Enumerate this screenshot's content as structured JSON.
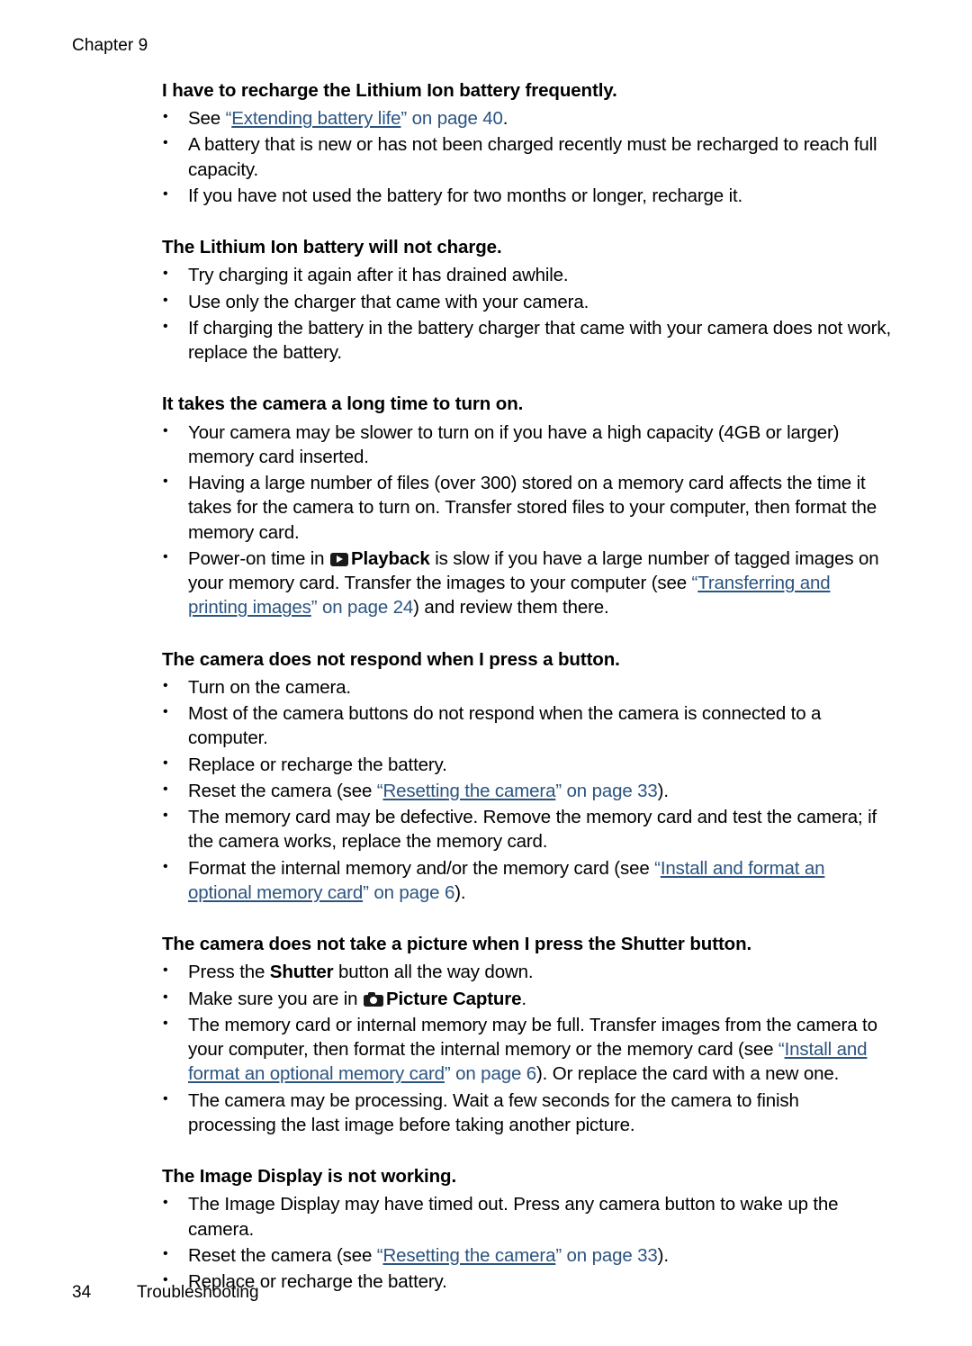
{
  "page": {
    "running_head": "Chapter 9",
    "footer_page_number": "34",
    "footer_section": "Troubleshooting",
    "link_color": "#2b5480",
    "text_color": "#000000",
    "background_color": "#ffffff"
  },
  "icons": {
    "playback": "playback-icon",
    "picture_capture": "camera-icon"
  },
  "sections": [
    {
      "heading": "I have to recharge the Lithium Ion battery frequently.",
      "bullets": [
        {
          "parts": [
            {
              "type": "text",
              "text": "See "
            },
            {
              "type": "quote",
              "text": "“"
            },
            {
              "type": "link",
              "text": "Extending battery life"
            },
            {
              "type": "quote",
              "text": "”"
            },
            {
              "type": "pagenum",
              "text": " on page 40"
            },
            {
              "type": "text",
              "text": "."
            }
          ]
        },
        {
          "parts": [
            {
              "type": "text",
              "text": "A battery that is new or has not been charged recently must be recharged to reach full capacity."
            }
          ]
        },
        {
          "parts": [
            {
              "type": "text",
              "text": "If you have not used the battery for two months or longer, recharge it."
            }
          ]
        }
      ]
    },
    {
      "heading": "The Lithium Ion battery will not charge.",
      "bullets": [
        {
          "parts": [
            {
              "type": "text",
              "text": "Try charging it again after it has drained awhile."
            }
          ]
        },
        {
          "parts": [
            {
              "type": "text",
              "text": "Use only the charger that came with your camera."
            }
          ]
        },
        {
          "parts": [
            {
              "type": "text",
              "text": "If charging the battery in the battery charger that came with your camera does not work, replace the battery."
            }
          ]
        }
      ]
    },
    {
      "heading": "It takes the camera a long time to turn on.",
      "bullets": [
        {
          "parts": [
            {
              "type": "text",
              "text": "Your camera may be slower to turn on if you have a high capacity (4GB or larger) memory card inserted."
            }
          ]
        },
        {
          "parts": [
            {
              "type": "text",
              "text": "Having a large number of files (over 300) stored on a memory card affects the time it takes for the camera to turn on. Transfer stored files to your computer, then format the memory card."
            }
          ]
        },
        {
          "parts": [
            {
              "type": "text",
              "text": "Power-on time in "
            },
            {
              "type": "icon",
              "icon": "playback"
            },
            {
              "type": "bold",
              "text": "Playback"
            },
            {
              "type": "text",
              "text": " is slow if you have a large number of tagged images on your memory card. Transfer the images to your computer (see "
            },
            {
              "type": "quote",
              "text": "“"
            },
            {
              "type": "link",
              "text": "Transferring and printing images"
            },
            {
              "type": "quote",
              "text": "”"
            },
            {
              "type": "pagenum",
              "text": " on page 24"
            },
            {
              "type": "text",
              "text": ") and review them there."
            }
          ]
        }
      ]
    },
    {
      "heading": "The camera does not respond when I press a button.",
      "bullets": [
        {
          "parts": [
            {
              "type": "text",
              "text": "Turn on the camera."
            }
          ]
        },
        {
          "parts": [
            {
              "type": "text",
              "text": "Most of the camera buttons do not respond when the camera is connected to a computer."
            }
          ]
        },
        {
          "parts": [
            {
              "type": "text",
              "text": "Replace or recharge the battery."
            }
          ]
        },
        {
          "parts": [
            {
              "type": "text",
              "text": "Reset the camera (see "
            },
            {
              "type": "quote",
              "text": "“"
            },
            {
              "type": "link",
              "text": "Resetting the camera"
            },
            {
              "type": "quote",
              "text": "”"
            },
            {
              "type": "pagenum",
              "text": " on page 33"
            },
            {
              "type": "text",
              "text": ")."
            }
          ]
        },
        {
          "parts": [
            {
              "type": "text",
              "text": "The memory card may be defective. Remove the memory card and test the camera; if the camera works, replace the memory card."
            }
          ]
        },
        {
          "parts": [
            {
              "type": "text",
              "text": "Format the internal memory and/or the memory card (see "
            },
            {
              "type": "quote",
              "text": "“"
            },
            {
              "type": "link",
              "text": "Install and format an optional memory card"
            },
            {
              "type": "quote",
              "text": "”"
            },
            {
              "type": "pagenum",
              "text": " on page 6"
            },
            {
              "type": "text",
              "text": ")."
            }
          ]
        }
      ]
    },
    {
      "heading": "The camera does not take a picture when I press the Shutter button.",
      "bullets": [
        {
          "parts": [
            {
              "type": "text",
              "text": "Press the "
            },
            {
              "type": "bold",
              "text": "Shutter"
            },
            {
              "type": "text",
              "text": " button all the way down."
            }
          ]
        },
        {
          "parts": [
            {
              "type": "text",
              "text": "Make sure you are in "
            },
            {
              "type": "icon",
              "icon": "picture_capture"
            },
            {
              "type": "bold",
              "text": "Picture Capture"
            },
            {
              "type": "text",
              "text": "."
            }
          ]
        },
        {
          "parts": [
            {
              "type": "text",
              "text": "The memory card or internal memory may be full. Transfer images from the camera to your computer, then format the internal memory or the memory card (see "
            },
            {
              "type": "quote",
              "text": "“"
            },
            {
              "type": "link",
              "text": "Install and format an optional memory card"
            },
            {
              "type": "quote",
              "text": "”"
            },
            {
              "type": "pagenum",
              "text": " on page 6"
            },
            {
              "type": "text",
              "text": "). Or replace the card with a new one."
            }
          ]
        },
        {
          "parts": [
            {
              "type": "text",
              "text": "The camera may be processing. Wait a few seconds for the camera to finish processing the last image before taking another picture."
            }
          ]
        }
      ]
    },
    {
      "heading": "The Image Display is not working.",
      "bullets": [
        {
          "parts": [
            {
              "type": "text",
              "text": "The Image Display may have timed out. Press any camera button to wake up the camera."
            }
          ]
        },
        {
          "parts": [
            {
              "type": "text",
              "text": "Reset the camera (see "
            },
            {
              "type": "quote",
              "text": "“"
            },
            {
              "type": "link",
              "text": "Resetting the camera"
            },
            {
              "type": "quote",
              "text": "”"
            },
            {
              "type": "pagenum",
              "text": " on page 33"
            },
            {
              "type": "text",
              "text": ")."
            }
          ]
        },
        {
          "parts": [
            {
              "type": "text",
              "text": "Replace or recharge the battery."
            }
          ]
        }
      ]
    }
  ]
}
